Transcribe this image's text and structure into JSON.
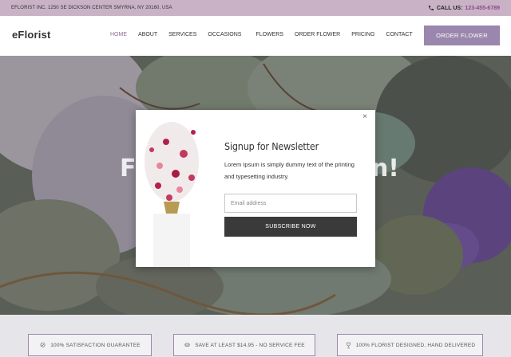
{
  "topbar": {
    "address": "EFLORIST INC. 1250 SE DICKSON CENTER SMYRNA, NY 20160, USA",
    "call_label": "CALL US:",
    "phone": "123-455-6789"
  },
  "header": {
    "logo": "eFlorist",
    "menu": [
      "HOME",
      "ABOUT",
      "SERVICES",
      "OCCASIONS",
      "FLOWERS",
      "ORDER FLOWER",
      "PRICING",
      "CONTACT"
    ],
    "active_item": "HOME",
    "order_button": "ORDER FLOWER"
  },
  "hero": {
    "heading_left": "F",
    "heading_right": "n!"
  },
  "modal": {
    "title": "Signup for Newsletter",
    "body": "Lorem Ipsum is simply dummy text of the printing and typesetting industry.",
    "email_placeholder": "Email address",
    "subscribe_label": "SUBSCRIBE NOW",
    "close_icon": "close-icon"
  },
  "features": [
    {
      "icon": "badge-icon",
      "label": "100% SATISFACTION GUARANTEE"
    },
    {
      "icon": "coins-icon",
      "label": "SAVE AT LEAST $14.95 - NO SERVICE FEE"
    },
    {
      "icon": "trophy-icon",
      "label": "100% FLORIST DESIGNED, HAND DELIVERED"
    }
  ],
  "colors": {
    "topbar_bg": "#c9b2c6",
    "accent": "#9b86ad",
    "subscribe_bg": "#3a3a3a"
  }
}
